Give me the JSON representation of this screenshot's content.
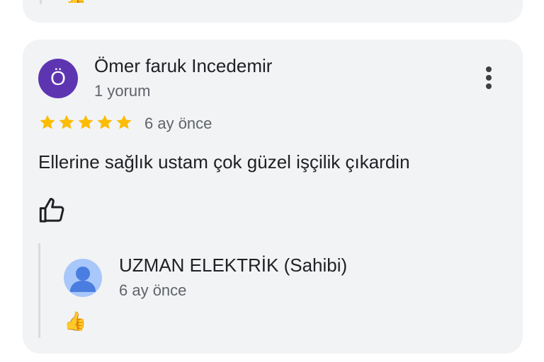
{
  "previous_card": {
    "thumb_emoji": "👍"
  },
  "review": {
    "avatar_letter": "Ö",
    "avatar_color": "#5e35b1",
    "author_name": "Ömer faruk Incedemir",
    "author_meta": "1 yorum",
    "rating": 5,
    "star_color": "#fbbc04",
    "date": "6 ay önce",
    "text": "Ellerine sağlık ustam çok güzel işçilik çıkardin",
    "more_icon": "more-vertical-icon",
    "like_icon": "thumbs-up-outline-icon"
  },
  "owner_reply": {
    "name": "UZMAN ELEKTRİK (Sahibi)",
    "date": "6 ay önce",
    "avatar_icon": "default-person-icon",
    "avatar_color": "#a8c7fa",
    "like_emoji": "👍"
  }
}
